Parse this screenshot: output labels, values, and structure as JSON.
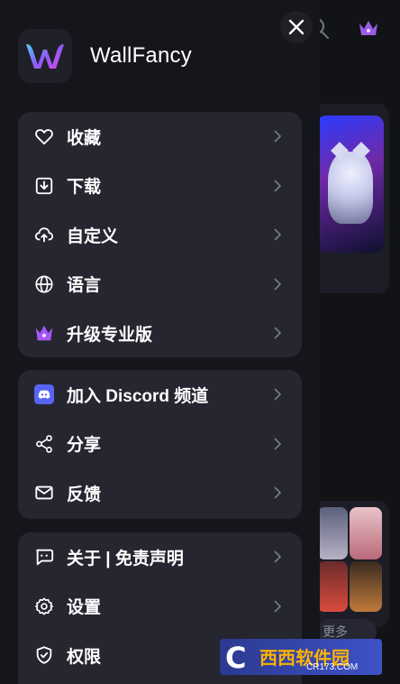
{
  "app": {
    "name": "WallFancy"
  },
  "background": {
    "more_label": "更多"
  },
  "menu": {
    "group1": [
      {
        "label": "收藏",
        "icon": "heart-icon"
      },
      {
        "label": "下载",
        "icon": "download-icon"
      },
      {
        "label": "自定义",
        "icon": "cloud-upload-icon"
      },
      {
        "label": "语言",
        "icon": "globe-icon"
      },
      {
        "label": "升级专业版",
        "icon": "crown-icon"
      }
    ],
    "group2": [
      {
        "label": "加入 Discord 频道",
        "icon": "discord-icon"
      },
      {
        "label": "分享",
        "icon": "share-icon"
      },
      {
        "label": "反馈",
        "icon": "mail-icon"
      }
    ],
    "group3": [
      {
        "label": "关于 | 免责声明",
        "icon": "chat-icon"
      },
      {
        "label": "设置",
        "icon": "gear-icon"
      },
      {
        "label": "权限",
        "icon": "shield-icon"
      }
    ]
  },
  "watermark": {
    "brand": "西西软件园",
    "site": "CR173.COM",
    "logo_letter": "C"
  },
  "colors": {
    "drawer_bg": "#15161c",
    "group_bg": "#252630",
    "accent_purple": "#a855f7",
    "discord": "#5865f2",
    "watermark_blue": "#3e52c8",
    "watermark_orange": "#ffb300"
  }
}
